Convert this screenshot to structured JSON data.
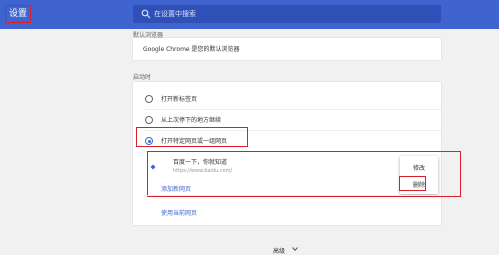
{
  "header": {
    "title": "设置",
    "search_placeholder": "在设置中搜索"
  },
  "default_browser": {
    "section_label": "默认浏览器",
    "text": "Google Chrome 是您的默认浏览器"
  },
  "startup": {
    "section_label": "启动时",
    "options": [
      {
        "label": "打开新标签页",
        "checked": false
      },
      {
        "label": "从上次停下的地方继续",
        "checked": false
      },
      {
        "label": "打开特定网页或一组网页",
        "checked": true
      }
    ],
    "pages": [
      {
        "name": "百度一下，你就知道",
        "url": "https://www.baidu.com/"
      }
    ],
    "menu": {
      "edit": "修改",
      "delete": "删除"
    },
    "add_page": "添加新网页",
    "use_current": "使用当前网页"
  },
  "footer": {
    "advanced": "高级"
  },
  "colors": {
    "accent": "#3f64cf",
    "highlight": "#d8202a"
  }
}
